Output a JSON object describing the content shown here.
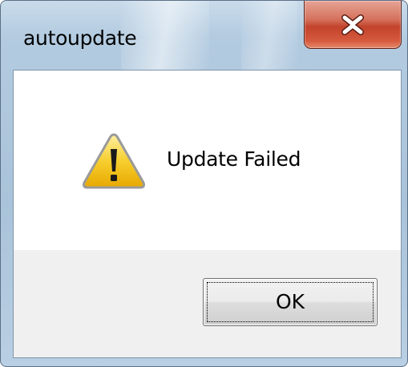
{
  "window": {
    "title": "autoupdate",
    "close_icon": "close-icon",
    "frame_color": "#b3cbe0",
    "close_button_color": "#c2432b"
  },
  "dialog": {
    "icon": "warning-icon",
    "icon_color": "#f5c518",
    "message": "Update Failed"
  },
  "buttons": {
    "ok_label": "OK"
  }
}
